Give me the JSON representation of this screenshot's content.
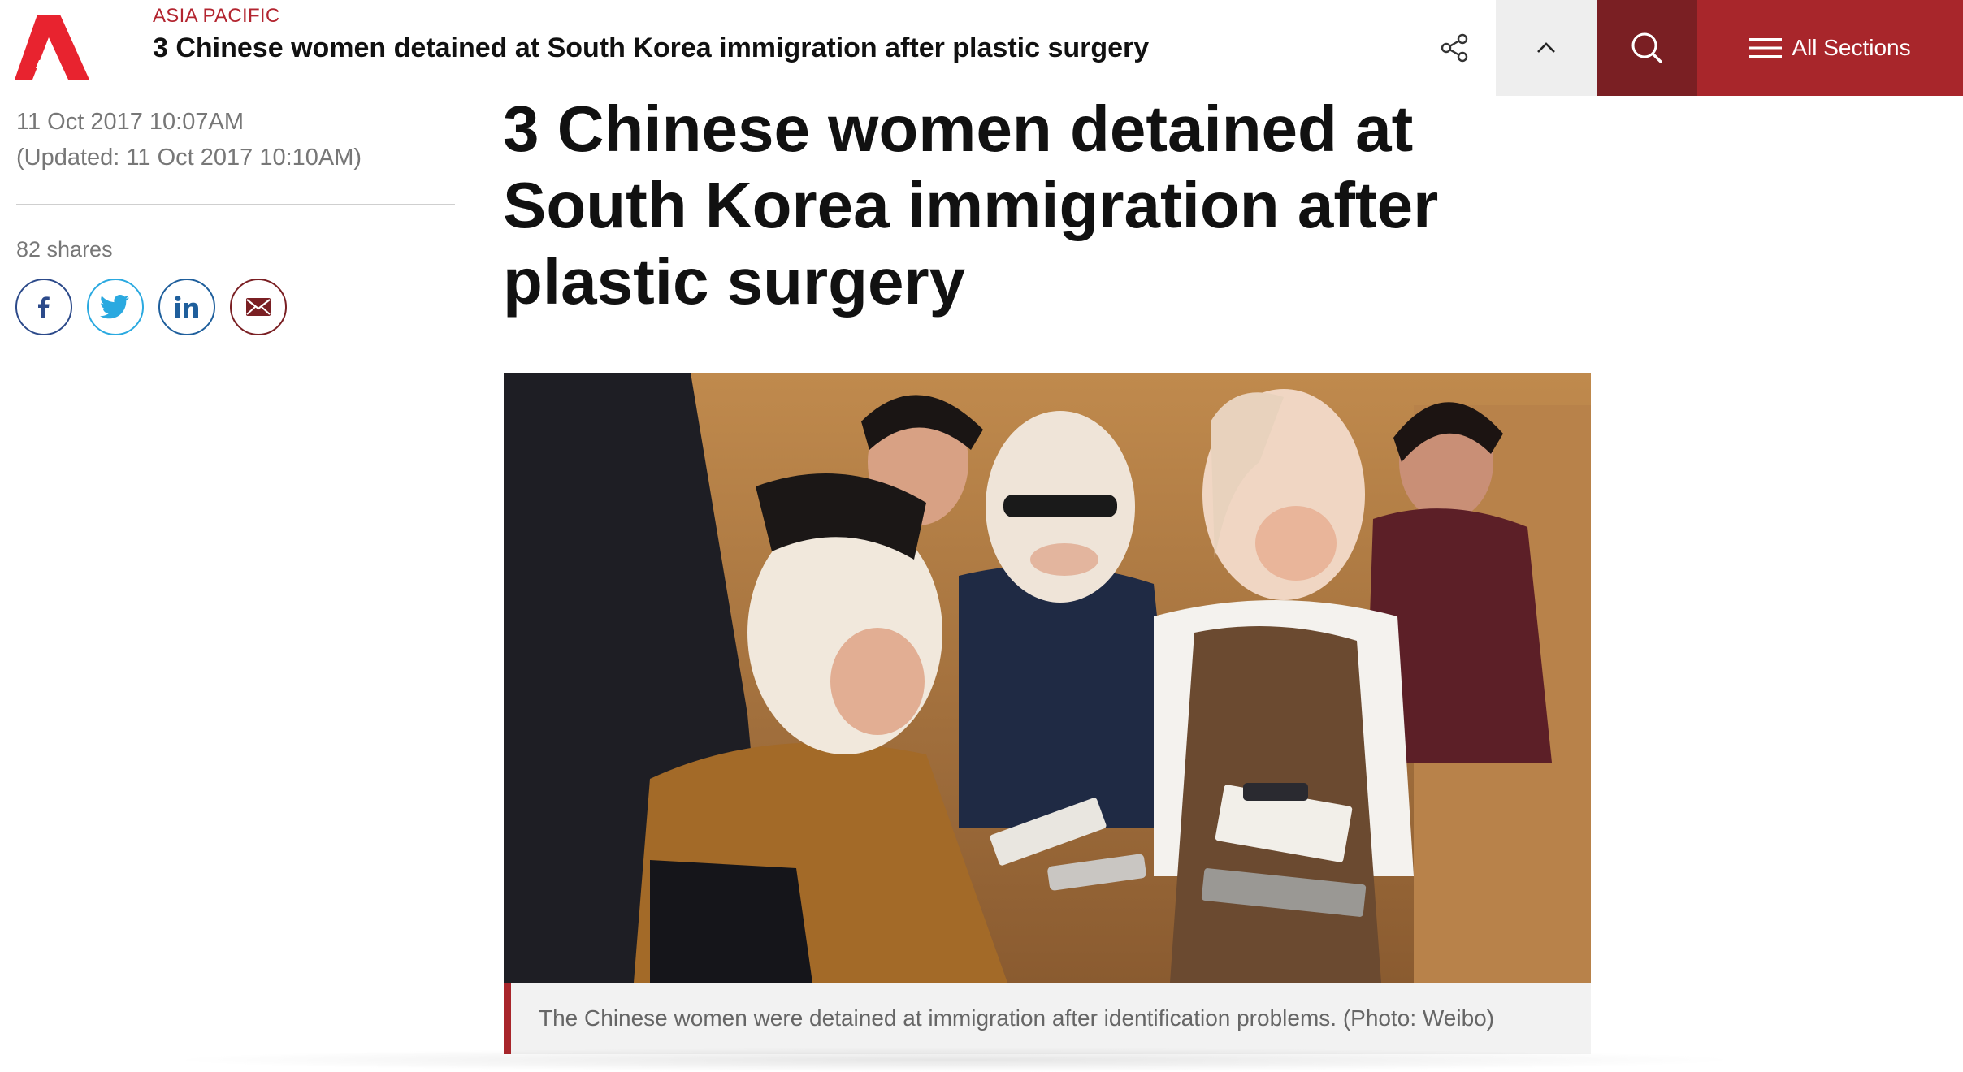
{
  "header": {
    "section": "ASIA PACIFIC",
    "title": "3 Chinese women detained at South Korea immigration after plastic surgery",
    "all_sections_label": "All Sections",
    "icons": {
      "logo": "channel-newsasia-logo",
      "share": "share-icon",
      "up": "chevron-up-icon",
      "search": "search-icon",
      "menu": "hamburger-menu-icon"
    },
    "colors": {
      "brand_red": "#a8262b",
      "dark_red": "#7a1f23",
      "section_red": "#b32530"
    }
  },
  "meta": {
    "published": "11 Oct 2017 10:07AM",
    "updated": "(Updated: 11 Oct 2017 10:10AM)",
    "shares": "82 shares",
    "social": [
      "facebook-icon",
      "twitter-icon",
      "linkedin-icon",
      "email-icon"
    ]
  },
  "article": {
    "title": "3 Chinese women detained at South Korea immigration after plastic surgery",
    "caption": "The Chinese women were detained at immigration after identification problems. (Photo: Weibo)"
  }
}
